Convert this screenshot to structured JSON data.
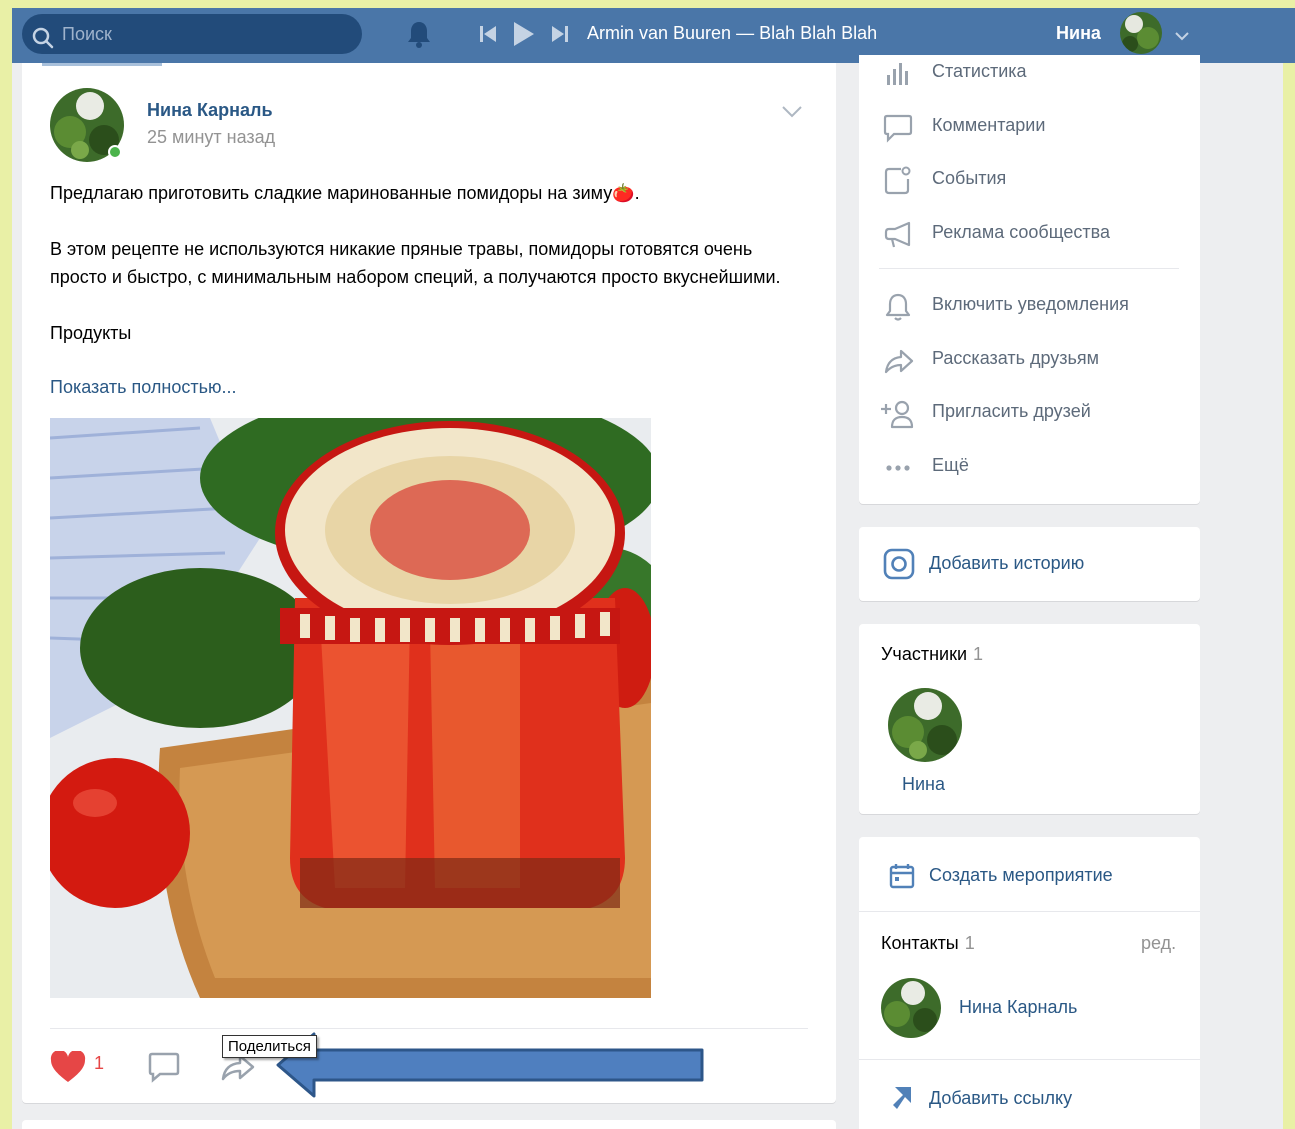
{
  "topbar": {
    "search_placeholder": "Поиск",
    "track": "Armin van Buuren — Blah Blah Blah",
    "user_name": "Нина"
  },
  "post": {
    "author": "Нина Карналь",
    "time": "25 минут назад",
    "text_line1": "Предлагаю приготовить сладкие маринованные помидоры на зиму🍅.",
    "text_para2": "В этом рецепте не используются никакие пряные травы, помидоры готовятся очень просто и быстро, с минимальным набором специй, а получаются просто вкуснейшими.",
    "text_products": "Продукты",
    "show_more": "Показать полностью...",
    "likes": "1",
    "share_tooltip": "Поделиться"
  },
  "sidebar": {
    "menu": [
      {
        "label": "Статистика",
        "icon": "stats-icon"
      },
      {
        "label": "Комментарии",
        "icon": "comment-icon"
      },
      {
        "label": "События",
        "icon": "events-icon"
      },
      {
        "label": "Реклама сообщества",
        "icon": "megaphone-icon"
      },
      {
        "label": "Включить уведомления",
        "icon": "bell-icon"
      },
      {
        "label": "Рассказать друзьям",
        "icon": "share-icon"
      },
      {
        "label": "Пригласить друзей",
        "icon": "add-user-icon"
      },
      {
        "label": "Ещё",
        "icon": "more-icon"
      }
    ],
    "add_story": "Добавить историю",
    "members_title": "Участники",
    "members_count": "1",
    "member_name": "Нина",
    "create_event": "Создать мероприятие",
    "contacts_title": "Контакты",
    "contacts_count": "1",
    "contacts_edit": "ред.",
    "contact_name": "Нина Карналь",
    "add_link": "Добавить ссылку"
  },
  "colors": {
    "header": "#4a76a8",
    "link": "#2a5885",
    "like": "#e64646",
    "annotation_arrow": "#4f7fbf",
    "frame": "#e9f0a6"
  }
}
